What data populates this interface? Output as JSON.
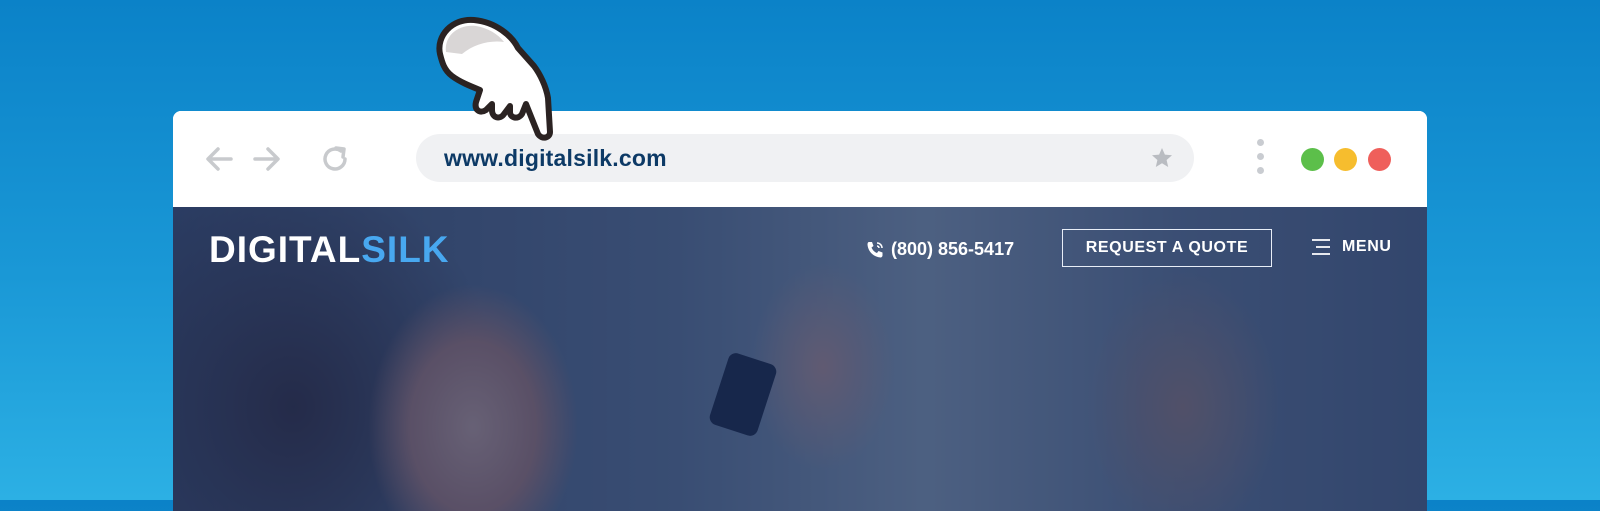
{
  "browser": {
    "url": "www.digitalsilk.com",
    "window_controls": [
      "green",
      "yellow",
      "red"
    ],
    "colors": {
      "green": "#5cbf4a",
      "yellow": "#f6bd2e",
      "red": "#ef5f5b"
    },
    "icons": [
      "back-arrow-icon",
      "forward-arrow-icon",
      "reload-icon",
      "star-icon",
      "kebab-menu-icon"
    ]
  },
  "site": {
    "logo_part1": "DIGITAL",
    "logo_part2": "SILK",
    "phone": "(800) 856-5417",
    "quote_label": "REQUEST A QUOTE",
    "menu_label": "MENU"
  },
  "colors": {
    "background": "#1a98d6",
    "logo_accent": "#48a8f0",
    "url_text": "#0d3a66"
  }
}
